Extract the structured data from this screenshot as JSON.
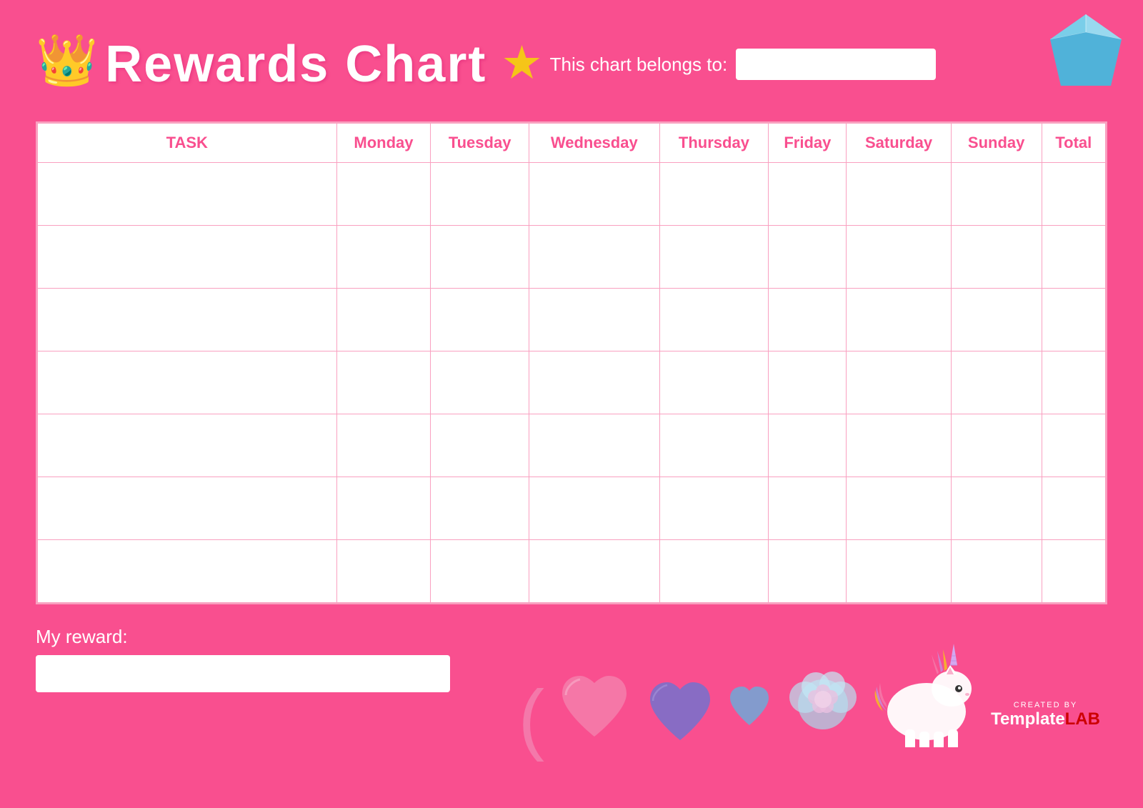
{
  "header": {
    "crown_emoji": "👑",
    "title": "Rewards Chart",
    "star_emoji": "⭐",
    "belongs_label": "This chart belongs to:",
    "belongs_placeholder": ""
  },
  "table": {
    "columns": [
      "TASK",
      "Monday",
      "Tuesday",
      "Wednesday",
      "Thursday",
      "Friday",
      "Saturday",
      "Sunday",
      "Total"
    ],
    "rows": 7
  },
  "bottom": {
    "reward_label": "My reward:",
    "reward_placeholder": ""
  },
  "branding": {
    "created_by": "CREATED BY",
    "brand_template": "Template",
    "brand_lab": "LAB"
  },
  "colors": {
    "background": "#f94f8f",
    "pink_light": "#f9a0c0",
    "white": "#ffffff",
    "header_text": "#f94f8f"
  }
}
